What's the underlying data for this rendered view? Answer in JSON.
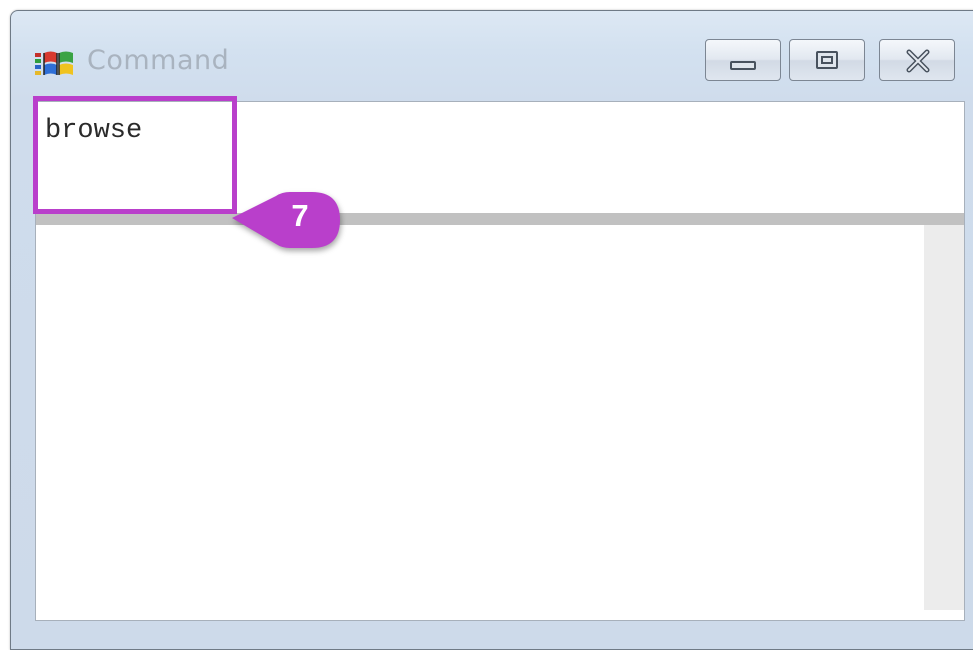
{
  "window": {
    "title": "Command",
    "icon": "windows-flag-icon",
    "controls": {
      "minimize_icon": "minimize-icon",
      "maximize_icon": "maximize-icon",
      "close_icon": "close-icon"
    }
  },
  "command": {
    "input_value": "browse"
  },
  "annotation": {
    "step_number": "7",
    "color": "#b93fcb"
  },
  "colors": {
    "title_text": "#a9b3bf",
    "splitter": "#c1c1c1",
    "callout": "#b93fcb"
  }
}
